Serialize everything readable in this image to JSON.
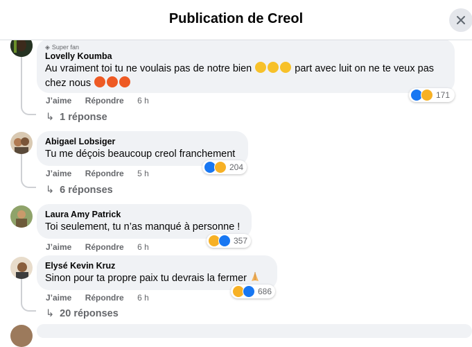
{
  "header": {
    "title": "Publication de Creol"
  },
  "comments": [
    {
      "badge": "Super fan",
      "author": "Lovelly Koumba",
      "text_line1_a": "Au vraiment toi tu ne voulais pas de notre bien",
      "text_line1_b": "part avec luit on ne te veux pas",
      "text_line2": "chez nous",
      "like_label": "J’aime",
      "reply_label": "Répondre",
      "time": "6 h",
      "reaction_count": "171",
      "replies_label": "1 réponse"
    },
    {
      "author": "Abigael Lobsiger",
      "text": "Tu me déçois beaucoup creol franchement",
      "like_label": "J’aime",
      "reply_label": "Répondre",
      "time": "5 h",
      "reaction_count": "204",
      "replies_label": "6 réponses"
    },
    {
      "author": "Laura Amy Patrick",
      "text": "Toi seulement, tu n’as manqué à personne !",
      "like_label": "J’aime",
      "reply_label": "Répondre",
      "time": "6 h",
      "reaction_count": "357"
    },
    {
      "author": "Elysé Kevin Kruz",
      "text": "Sinon pour ta propre paix tu devrais la fermer",
      "like_label": "J’aime",
      "reply_label": "Répondre",
      "time": "6 h",
      "reaction_count": "686",
      "replies_label": "20 réponses"
    }
  ],
  "colors": {
    "like": "#1877f2",
    "haha": "#f7b125",
    "bubble": "#f0f2f5",
    "muted": "#65676b"
  },
  "icons": [
    "close-icon",
    "reply-arrow-icon",
    "like-reaction-icon",
    "haha-reaction-icon",
    "laughing-emoji",
    "angry-emoji",
    "praying-hands-emoji",
    "super-fan-diamond-icon"
  ]
}
